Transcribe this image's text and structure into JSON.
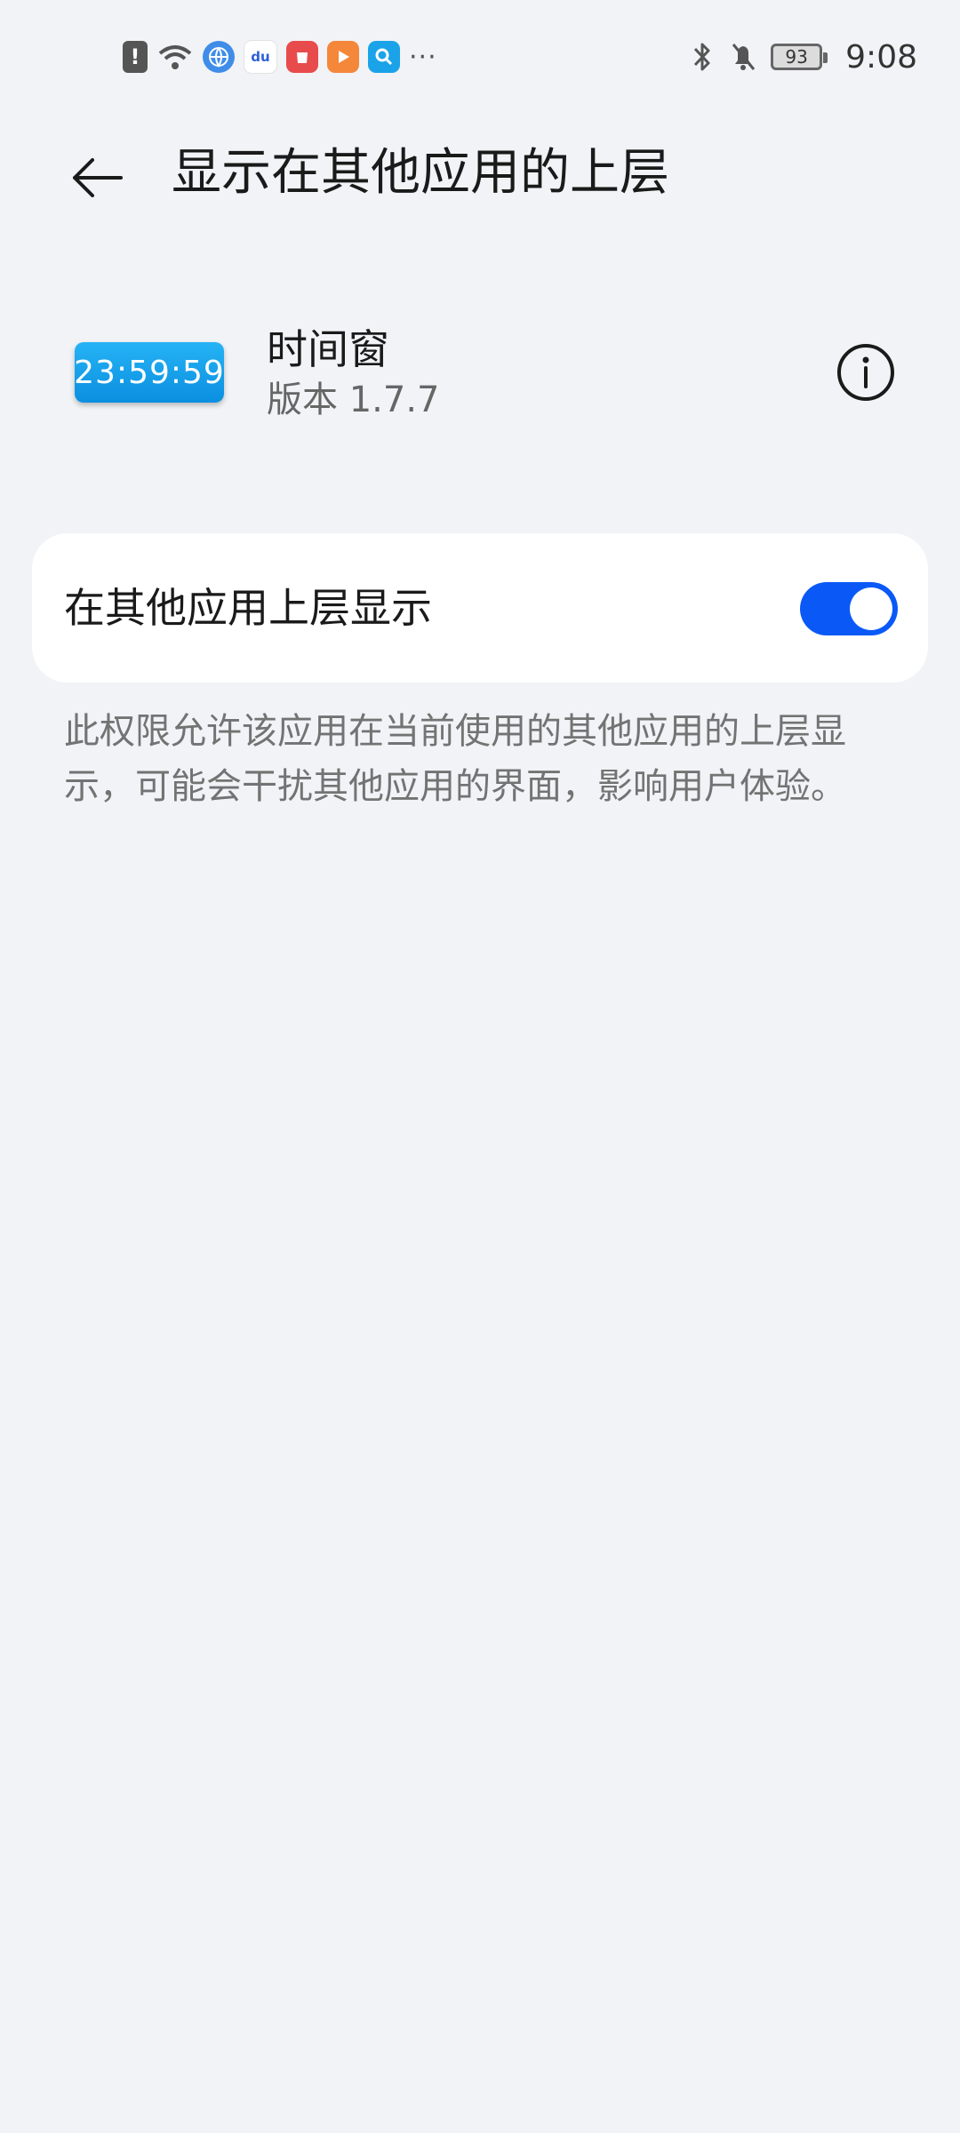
{
  "status_bar": {
    "time": "9:08",
    "battery": "93",
    "more": "···",
    "left_icons": [
      "alert-icon",
      "wifi-icon",
      "globe-app-icon",
      "baidu-app-icon",
      "huawei-app-icon",
      "video-app-icon",
      "search-app-icon"
    ],
    "right_icons": [
      "bluetooth-icon",
      "bell-off-icon",
      "battery-icon"
    ]
  },
  "header": {
    "title": "显示在其他应用的上层"
  },
  "app": {
    "icon_text": "23:59:59",
    "name": "时间窗",
    "version": "版本 1.7.7"
  },
  "permission": {
    "label": "在其他应用上层显示",
    "enabled": true
  },
  "description": "此权限允许该应用在当前使用的其他应用的上层显示，可能会干扰其他应用的界面，影响用户体验。",
  "colors": {
    "background": "#f1f3f6",
    "toggle_on": "#0a59f7",
    "app_icon": "#14a0ea"
  }
}
